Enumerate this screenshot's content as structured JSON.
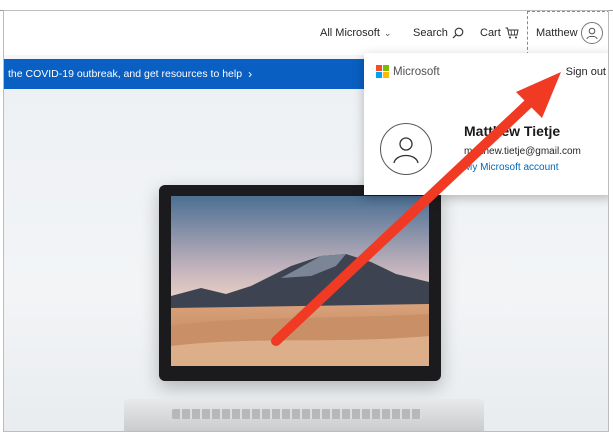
{
  "header": {
    "all_microsoft": "All Microsoft",
    "search": "Search",
    "cart": "Cart",
    "user_name": "Matthew"
  },
  "banner": {
    "text": "the COVID-19 outbreak, and get resources to help",
    "arrow": "›"
  },
  "account_menu": {
    "brand": "Microsoft",
    "sign_out": "Sign out",
    "full_name": "Matthew Tietje",
    "email": "matthew.tietje@gmail.com",
    "account_link": "My Microsoft account"
  },
  "colors": {
    "banner_bg": "#0a5fc2",
    "link": "#0067b8",
    "annotation_arrow": "#f03a24",
    "ms_red": "#f25022",
    "ms_green": "#7fba00",
    "ms_blue": "#00a4ef",
    "ms_yellow": "#ffb900"
  },
  "icons": {
    "search": "search-icon",
    "cart": "cart-icon",
    "avatar": "person-icon",
    "dropdown": "chevron-down-icon"
  }
}
